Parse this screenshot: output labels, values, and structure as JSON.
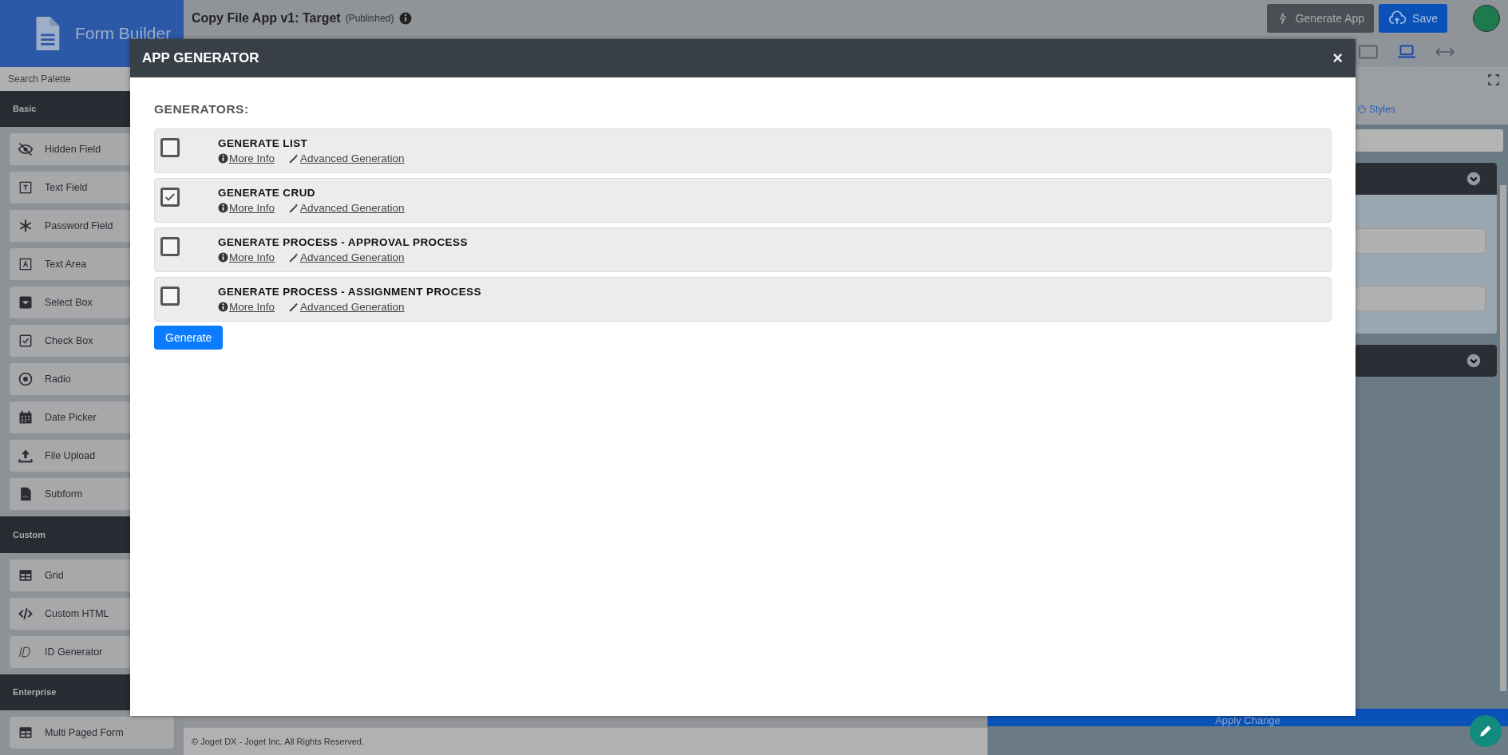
{
  "header": {
    "brand": "Form Builder",
    "title": "Copy File App v1: Target",
    "status": "(Published)",
    "buttons": [
      {
        "label": "Generate App",
        "kind": "dark"
      },
      {
        "label": "Save",
        "kind": "primary"
      }
    ]
  },
  "toolbar": {
    "devices": [
      {
        "kind": "tablet",
        "selected": false
      },
      {
        "kind": "laptop",
        "selected": true
      },
      {
        "kind": "stretch",
        "selected": false
      }
    ]
  },
  "sidebar": {
    "search": {
      "placeholder": "Search Palette"
    },
    "sections": [
      {
        "title": "Basic",
        "items": [
          {
            "label": "Hidden Field",
            "kind": "hidden"
          },
          {
            "label": "Text Field",
            "kind": "text"
          },
          {
            "label": "Password Field",
            "kind": "password"
          },
          {
            "label": "Text Area",
            "kind": "textarea"
          },
          {
            "label": "Select Box",
            "kind": "select"
          },
          {
            "label": "Check Box",
            "kind": "checkbox"
          },
          {
            "label": "Radio",
            "kind": "radio"
          },
          {
            "label": "Date Picker",
            "kind": "date"
          },
          {
            "label": "File Upload",
            "kind": "upload"
          },
          {
            "label": "Subform",
            "kind": "subform"
          }
        ]
      },
      {
        "title": "Custom",
        "items": [
          {
            "label": "Grid",
            "kind": "grid"
          },
          {
            "label": "Custom HTML",
            "kind": "code"
          },
          {
            "label": "ID Generator",
            "kind": "id"
          }
        ]
      },
      {
        "title": "Enterprise",
        "items": [
          {
            "label": "Multi Paged Form",
            "kind": "grid"
          }
        ]
      }
    ]
  },
  "footer": "© Joget DX - Joget Inc. All Rights Reserved.",
  "properties": {
    "tab": "Styles",
    "apply": "Apply Change"
  },
  "modal": {
    "title": "APP GENERATOR",
    "close": "×",
    "heading": "GENERATORS:",
    "generators": [
      {
        "name": "GENERATE LIST",
        "checked": false,
        "links": [
          "More Info",
          "Advanced Generation"
        ]
      },
      {
        "name": "GENERATE CRUD",
        "checked": true,
        "links": [
          "More Info",
          "Advanced Generation"
        ]
      },
      {
        "name": "GENERATE PROCESS - APPROVAL PROCESS",
        "checked": false,
        "links": [
          "More Info",
          "Advanced Generation"
        ]
      },
      {
        "name": "GENERATE PROCESS - ASSIGNMENT PROCESS",
        "checked": false,
        "links": [
          "More Info",
          "Advanced Generation"
        ]
      }
    ],
    "button": "Generate"
  }
}
